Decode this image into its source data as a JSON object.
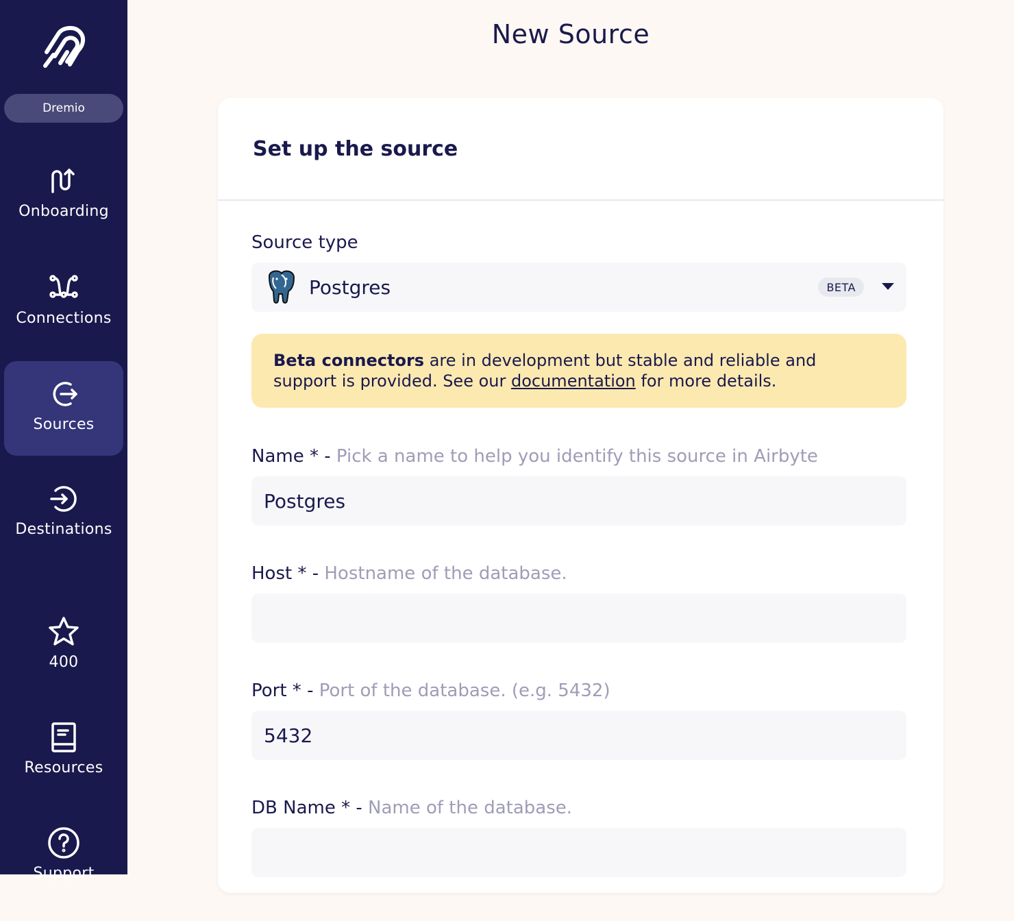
{
  "sidebar": {
    "workspace": "Dremio",
    "items": [
      {
        "label": "Onboarding",
        "icon": "onboarding-icon"
      },
      {
        "label": "Connections",
        "icon": "connections-icon"
      },
      {
        "label": "Sources",
        "icon": "sources-icon",
        "active": true
      },
      {
        "label": "Destinations",
        "icon": "destinations-icon"
      },
      {
        "label": "400",
        "icon": "star-icon"
      },
      {
        "label": "Resources",
        "icon": "book-icon"
      },
      {
        "label": "Support",
        "icon": "help-icon"
      }
    ]
  },
  "page": {
    "title": "New Source"
  },
  "card": {
    "title": "Set up the source"
  },
  "source_type": {
    "label": "Source type",
    "value": "Postgres",
    "badge": "BETA",
    "icon": "postgres-elephant-icon"
  },
  "notice": {
    "bold": "Beta connectors",
    "text1": " are in development but stable and reliable and support is provided. See our ",
    "link": "documentation",
    "text2": " for more details."
  },
  "fields": {
    "name": {
      "label": "Name * - ",
      "description": "Pick a name to help you identify this source in Airbyte",
      "value": "Postgres"
    },
    "host": {
      "label": "Host * - ",
      "description": "Hostname of the database.",
      "value": ""
    },
    "port": {
      "label": "Port * - ",
      "description": "Port of the database. (e.g. 5432)",
      "value": "5432"
    },
    "db_name": {
      "label": "DB Name * - ",
      "description": "Name of the database.",
      "value": ""
    }
  },
  "colors": {
    "sidebar_bg": "#1a194d",
    "active_bg": "#35357a",
    "page_bg": "#fdf8f3",
    "notice_bg": "#fce9b0",
    "field_bg": "#f7f7fa"
  }
}
